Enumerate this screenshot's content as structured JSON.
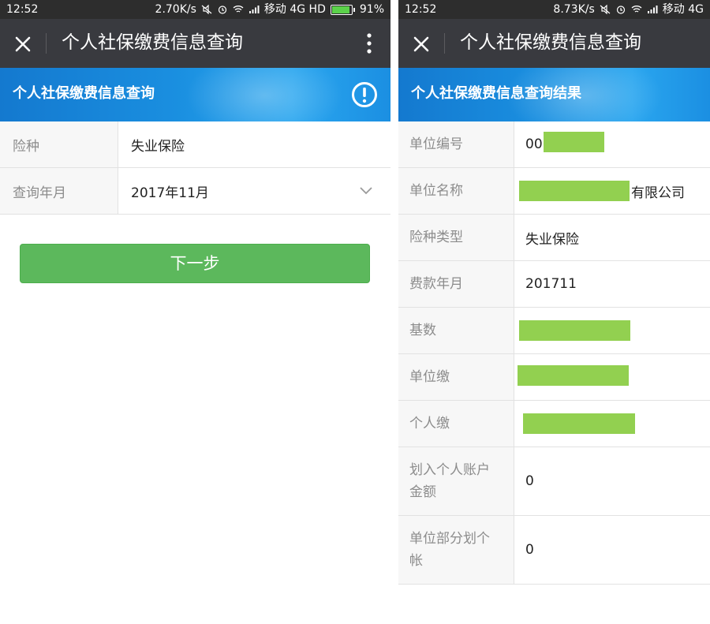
{
  "left": {
    "status": {
      "time": "12:52",
      "speed": "2.70K/s",
      "carrier": "移动 4G HD",
      "battery": "91%",
      "battery_level": 0.91
    },
    "nav": {
      "title": "个人社保缴费信息查询"
    },
    "banner": {
      "title": "个人社保缴费信息查询"
    },
    "form": {
      "rows": [
        {
          "label": "险种",
          "value": "失业保险"
        },
        {
          "label": "查询年月",
          "value": "2017年11月"
        }
      ]
    },
    "next_label": "下一步"
  },
  "right": {
    "status": {
      "time": "12:52",
      "speed": "8.73K/s",
      "carrier": "移动 4G"
    },
    "nav": {
      "title": "个人社保缴费信息查询"
    },
    "banner": {
      "title": "个人社保缴费信息查询结果"
    },
    "results": {
      "rows": [
        {
          "label": "单位编号",
          "value": "00"
        },
        {
          "label": "单位名称",
          "value": "有限公司"
        },
        {
          "label": "险种类型",
          "value": "失业保险"
        },
        {
          "label": "费款年月",
          "value": "201711"
        },
        {
          "label": "基数",
          "value": ""
        },
        {
          "label": "单位缴",
          "value": ""
        },
        {
          "label": "个人缴",
          "value": ""
        },
        {
          "label": "划入个人账户金额",
          "value": "0"
        },
        {
          "label": "单位部分划个帐",
          "value": "0"
        }
      ]
    }
  },
  "colors": {
    "statusbar": "#2d2d2d",
    "navbar": "#393a3f",
    "banner": "#1a8fe0",
    "button": "#5cb85c",
    "redaction": "#92d050"
  }
}
